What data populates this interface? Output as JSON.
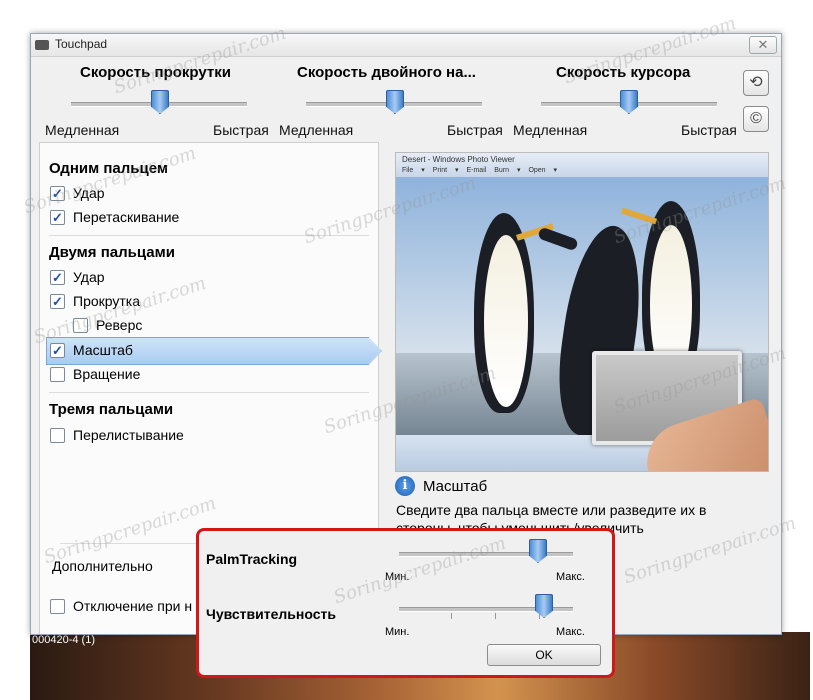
{
  "window": {
    "title": "Touchpad",
    "close_glyph": "✕"
  },
  "desktop": {
    "label": "000420-4 (1)"
  },
  "sliders": [
    {
      "title": "Скорость прокрутки",
      "min": "Медленная",
      "max": "Быстрая",
      "value": 0.5
    },
    {
      "title": "Скорость двойного на...",
      "min": "Медленная",
      "max": "Быстрая",
      "value": 0.5
    },
    {
      "title": "Скорость курсора",
      "min": "Медленная",
      "max": "Быстрая",
      "value": 0.5
    }
  ],
  "side_buttons": {
    "reset_icon": "⟲",
    "copyright_icon": "©"
  },
  "groups": {
    "one_finger": {
      "title": "Одним пальцем",
      "tap": "Удар",
      "drag": "Перетаскивание"
    },
    "two_finger": {
      "title": "Двумя пальцами",
      "tap": "Удар",
      "scroll": "Прокрутка",
      "reverse": "Реверс",
      "zoom": "Масштаб",
      "rotate": "Вращение"
    },
    "three_finger": {
      "title": "Тремя пальцами",
      "flick": "Перелистывание"
    }
  },
  "checks": {
    "one_tap": true,
    "one_drag": true,
    "two_tap": true,
    "two_scroll": true,
    "two_reverse": false,
    "two_zoom": true,
    "two_rotate": false,
    "three_flick": false
  },
  "advanced": {
    "label": "Дополнительно",
    "disable_label": "Отключение при н"
  },
  "preview": {
    "window_title": "Desert - Windows Photo Viewer",
    "menu": "File ▾  Print ▾  E-mail  Burn ▾  Open ▾"
  },
  "info": {
    "icon": "i",
    "title": "Масштаб",
    "desc_line1": "Сведите два пальца вместе или разведите их в",
    "desc_line2": "стороны, чтобы уменьшить/увеличить"
  },
  "popup": {
    "palm": {
      "label": "PalmTracking",
      "min": "Мин.",
      "max": "Макс.",
      "value": 0.8
    },
    "sensitivity": {
      "label": "Чувствительность",
      "min": "Мин.",
      "max": "Макс.",
      "value": 0.83
    },
    "ok": "OK"
  },
  "watermark": "Soringpcrepair.com",
  "colors": {
    "highlight_border": "#d01818",
    "slider_thumb": "#4d8fd8"
  }
}
